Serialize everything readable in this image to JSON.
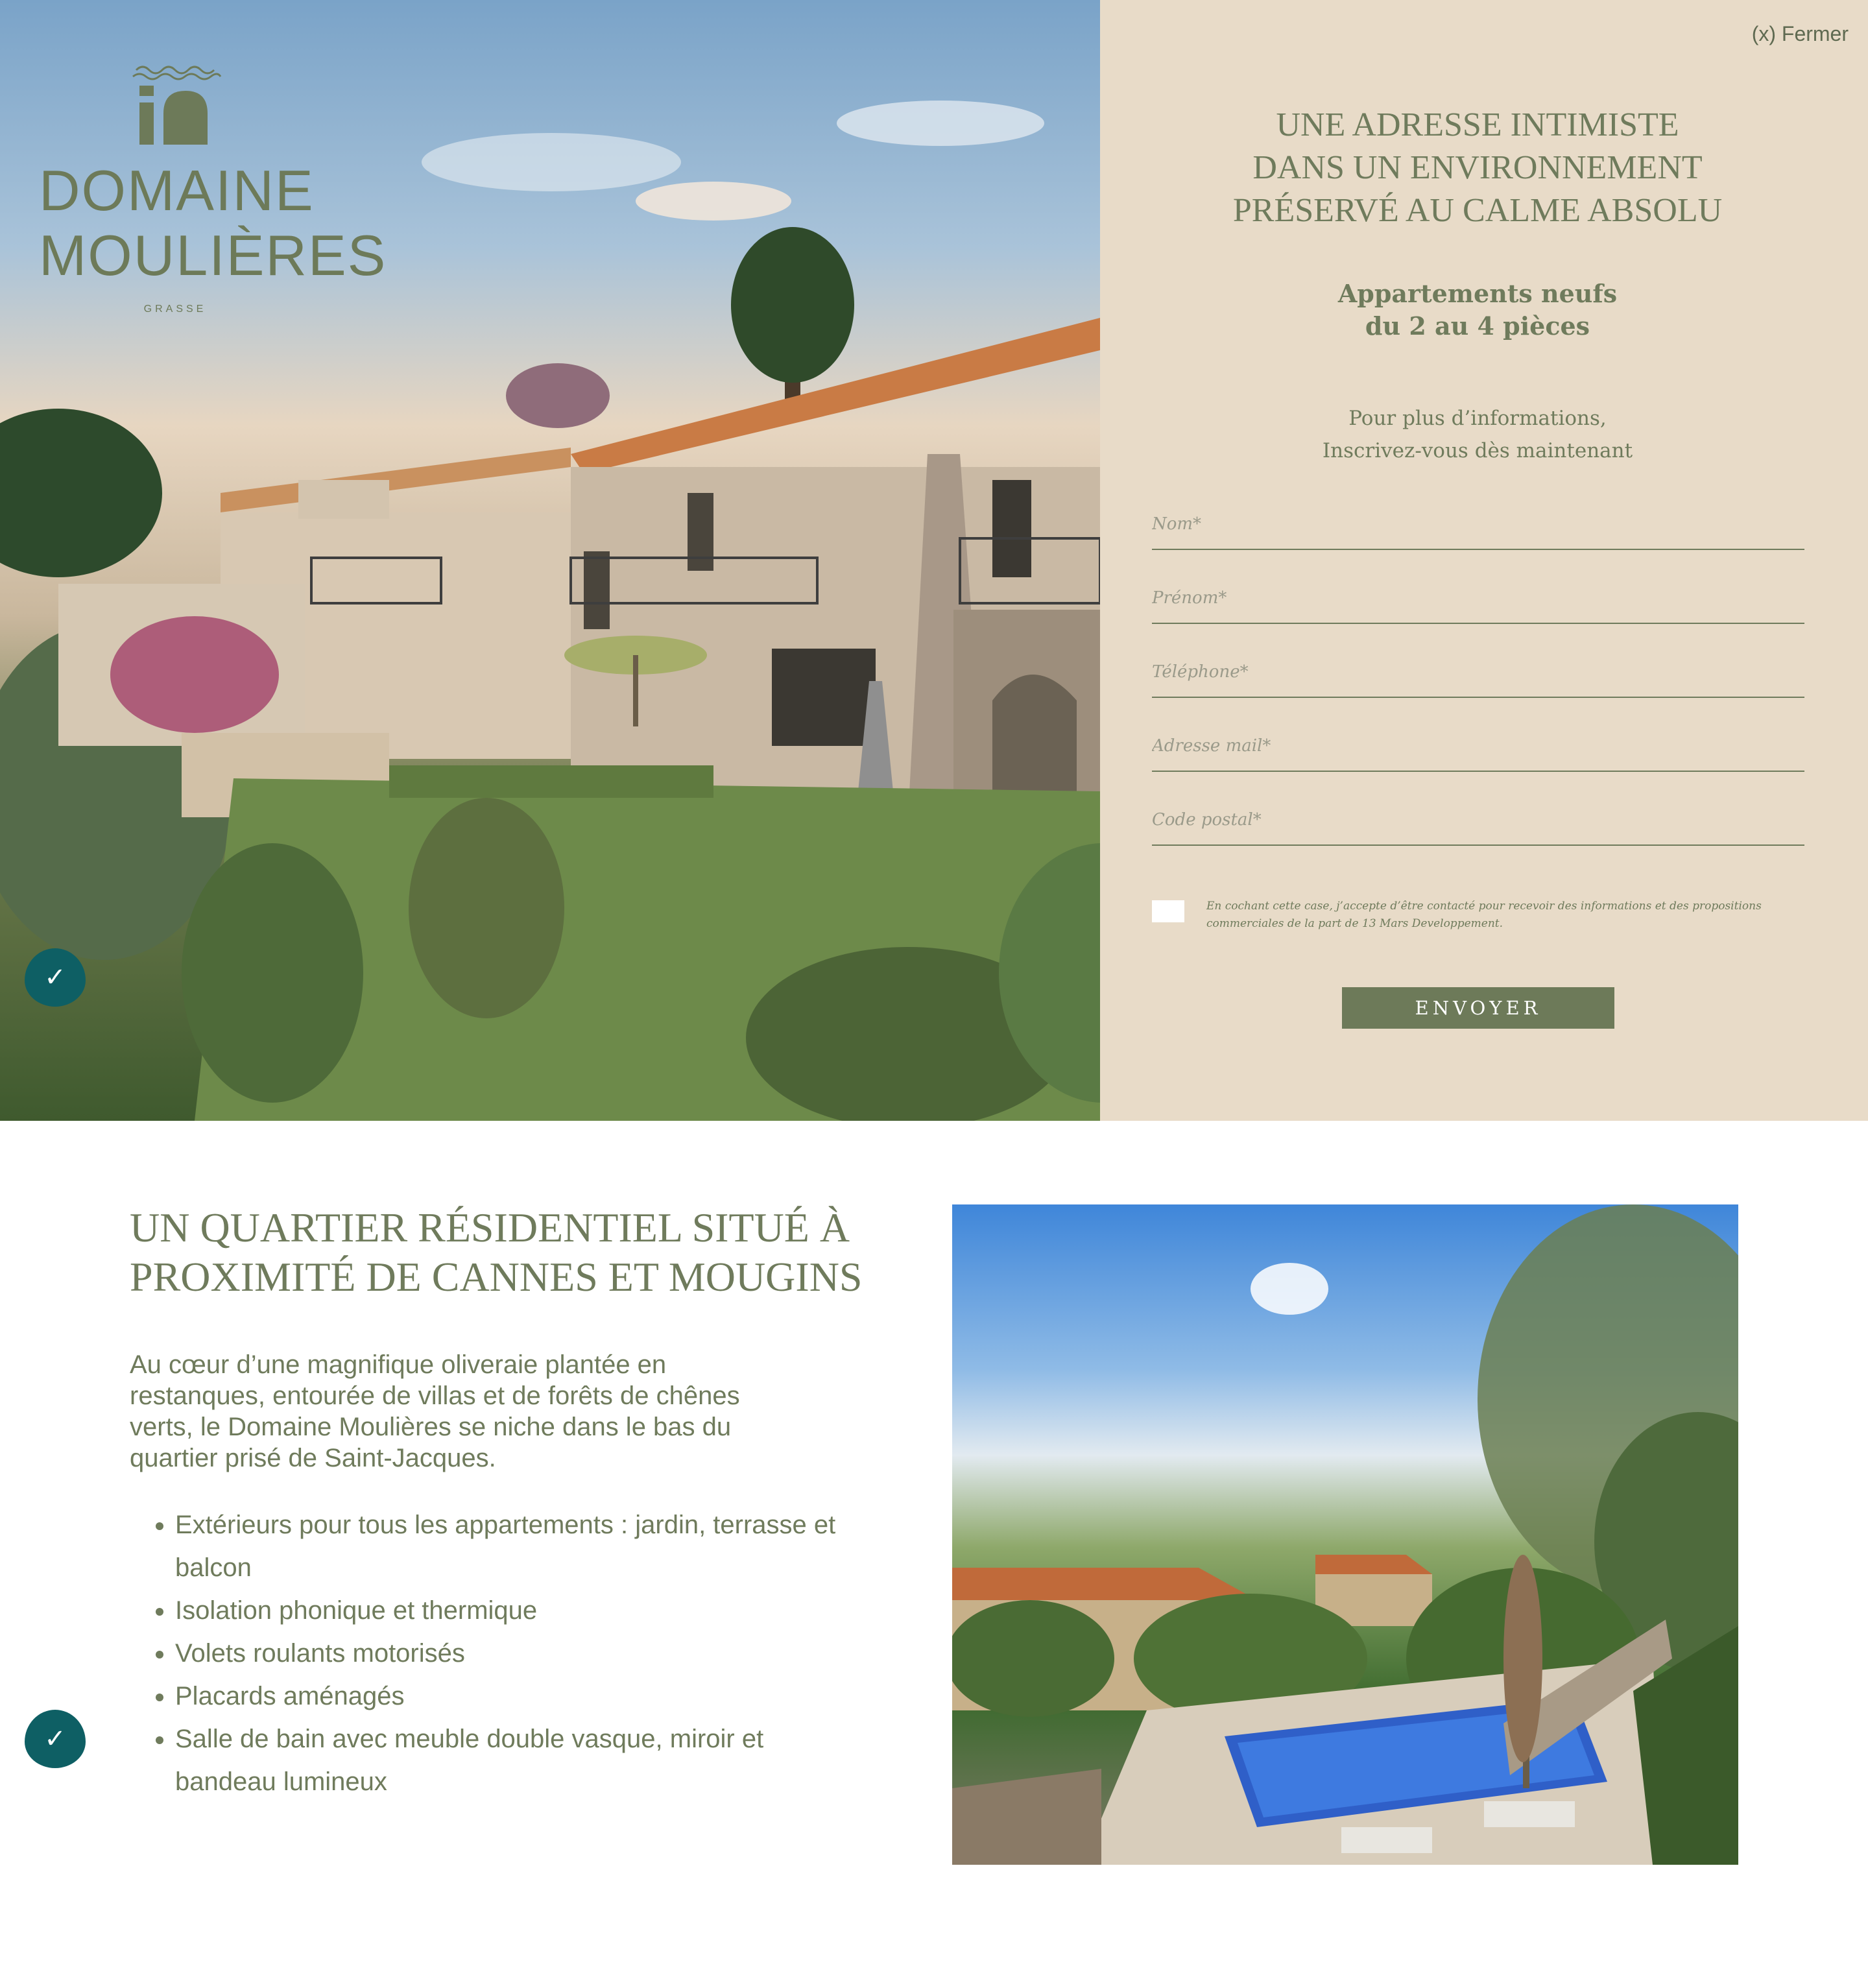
{
  "logo": {
    "line1": "DOMAINE",
    "line2": "MOULIÈRES",
    "place": "GRASSE"
  },
  "close": {
    "label": "(x) Fermer"
  },
  "panel": {
    "headline": "UNE ADRESSE INTIMISTE\nDANS UN ENVIRONNEMENT\nPRÉSERVÉ AU CALME ABSOLU",
    "subheadline": "Appartements neufs\ndu 2 au 4 pièces",
    "info": "Pour plus d’informations,\nInscrivez-vous dès maintenant"
  },
  "form": {
    "name_placeholder": "Nom*",
    "firstname_placeholder": "Prénom*",
    "phone_placeholder": "Téléphone*",
    "email_placeholder": "Adresse mail*",
    "postal_placeholder": "Code postal*",
    "consent_text": "En cochant cette case, j’accepte d’être contacté pour recevoir des informations et des propositions commerciales de la part de 13 Mars Developpement.",
    "submit_label": "ENVOYER"
  },
  "section2": {
    "title": "UN QUARTIER RÉSIDENTIEL SITUÉ À\nPROXIMITÉ DE CANNES ET MOUGINS",
    "paragraph": "Au cœur d’une magnifique oliveraie plantée en restanques, entourée de villas et de forêts de chênes verts, le Domaine Moulières se niche dans le bas du quartier prisé de Saint-Jacques.",
    "features": [
      "Extérieurs pour tous les appartements : jardin, terrasse et balcon",
      "Isolation phonique et thermique",
      "Volets roulants motorisés",
      "Placards aménagés",
      "Salle de bain avec meuble double vasque, miroir et bandeau lumineux"
    ]
  },
  "colors": {
    "brand_green": "#6d7a59",
    "panel_beige": "#e8dbc8",
    "badge_teal": "#0e5f64"
  },
  "icons": {
    "badge": "accessibility-check-icon",
    "logo": "domaine-arch-logo-icon"
  }
}
